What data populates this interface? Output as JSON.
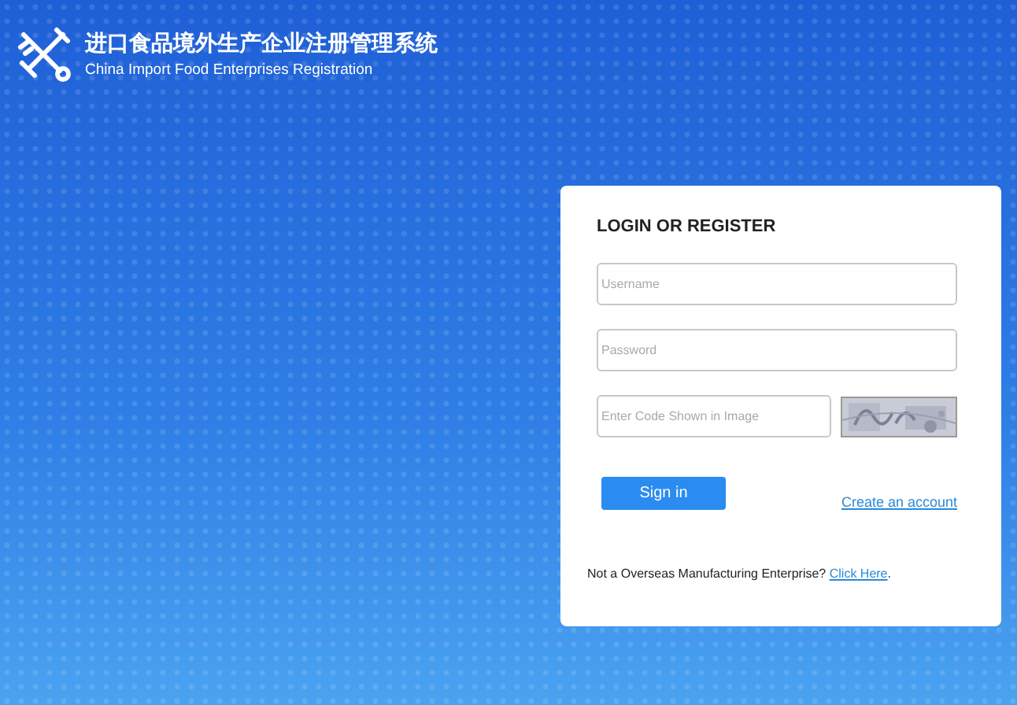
{
  "header": {
    "title": "进口食品境外生产企业注册管理系统",
    "subtitle": "China Import Food Enterprises Registration"
  },
  "login": {
    "heading": "LOGIN OR REGISTER",
    "fields": [
      {
        "placeholder": "Username"
      },
      {
        "placeholder": "Password"
      }
    ],
    "captcha": {
      "placeholder": "Enter Code Shown in Image"
    },
    "sign_in": "Sign in",
    "create_account": "Create an account",
    "footer": {
      "text": "Not a Overseas Manufacturing Enterprise?",
      "link": "Click Here",
      "end": "."
    }
  }
}
